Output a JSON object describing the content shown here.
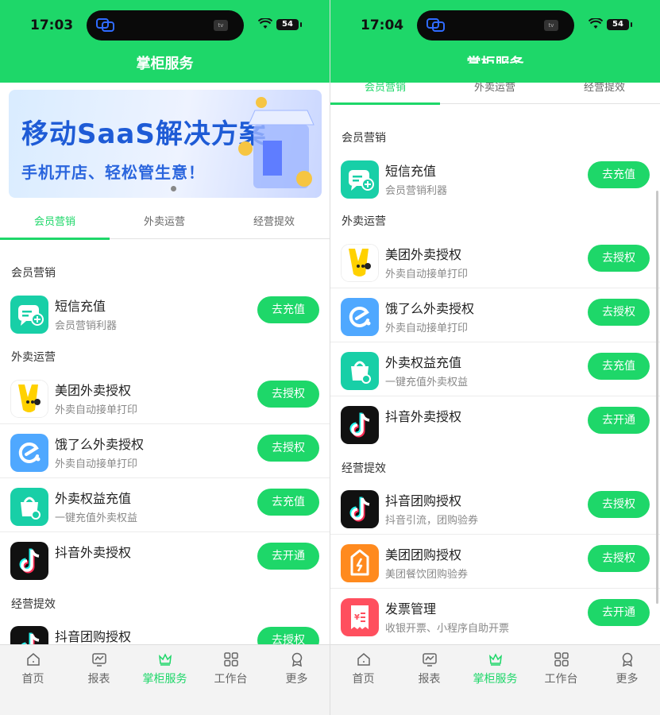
{
  "screen1": {
    "time": "17:03",
    "battery": "54",
    "title": "掌柜服务",
    "banner": {
      "title": "移动SaaS解决方案",
      "subtitle": "手机开店、轻松管生意！"
    },
    "tabs": [
      "会员营销",
      "外卖运营",
      "经营提效"
    ],
    "sections": [
      {
        "title": "会员营销",
        "items": [
          {
            "name": "短信充值",
            "desc": "会员营销利器",
            "action": "去充值",
            "icon": "sms-icon"
          }
        ]
      },
      {
        "title": "外卖运营",
        "items": [
          {
            "name": "美团外卖授权",
            "desc": "外卖自动接单打印",
            "action": "去授权",
            "icon": "meituan-icon"
          },
          {
            "name": "饿了么外卖授权",
            "desc": "外卖自动接单打印",
            "action": "去授权",
            "icon": "eleme-icon"
          },
          {
            "name": "外卖权益充值",
            "desc": "一键充值外卖权益",
            "action": "去充值",
            "icon": "takeout-bag-icon"
          },
          {
            "name": "抖音外卖授权",
            "desc": "",
            "action": "去开通",
            "icon": "douyin-icon"
          }
        ]
      },
      {
        "title": "经营提效",
        "items": [
          {
            "name": "抖音团购授权",
            "desc": "",
            "action": "去授权",
            "icon": "douyin-icon"
          }
        ]
      }
    ]
  },
  "screen2": {
    "time": "17:04",
    "battery": "54",
    "title": "掌柜服务",
    "tabs": [
      "会员营销",
      "外卖运营",
      "经营提效"
    ],
    "sections": [
      {
        "title": "会员营销",
        "items": [
          {
            "name": "短信充值",
            "desc": "会员营销利器",
            "action": "去充值",
            "icon": "sms-icon"
          }
        ]
      },
      {
        "title": "外卖运营",
        "items": [
          {
            "name": "美团外卖授权",
            "desc": "外卖自动接单打印",
            "action": "去授权",
            "icon": "meituan-icon"
          },
          {
            "name": "饿了么外卖授权",
            "desc": "外卖自动接单打印",
            "action": "去授权",
            "icon": "eleme-icon"
          },
          {
            "name": "外卖权益充值",
            "desc": "一键充值外卖权益",
            "action": "去充值",
            "icon": "takeout-bag-icon"
          },
          {
            "name": "抖音外卖授权",
            "desc": "",
            "action": "去开通",
            "icon": "douyin-icon"
          }
        ]
      },
      {
        "title": "经营提效",
        "items": [
          {
            "name": "抖音团购授权",
            "desc": "抖音引流，团购验券",
            "action": "去授权",
            "icon": "douyin-icon"
          },
          {
            "name": "美团团购授权",
            "desc": "美团餐饮团购验券",
            "action": "去授权",
            "icon": "meituan-group-icon"
          },
          {
            "name": "发票管理",
            "desc": "收银开票、小程序自助开票",
            "action": "去开通",
            "icon": "invoice-icon"
          }
        ]
      }
    ]
  },
  "nav": [
    {
      "label": "首页",
      "icon": "home-icon"
    },
    {
      "label": "报表",
      "icon": "report-icon"
    },
    {
      "label": "掌柜服务",
      "icon": "crown-icon"
    },
    {
      "label": "工作台",
      "icon": "grid-icon"
    },
    {
      "label": "更多",
      "icon": "more-icon"
    }
  ],
  "colors": {
    "accent": "#1ed769",
    "banner_text": "#1e5bd6"
  }
}
